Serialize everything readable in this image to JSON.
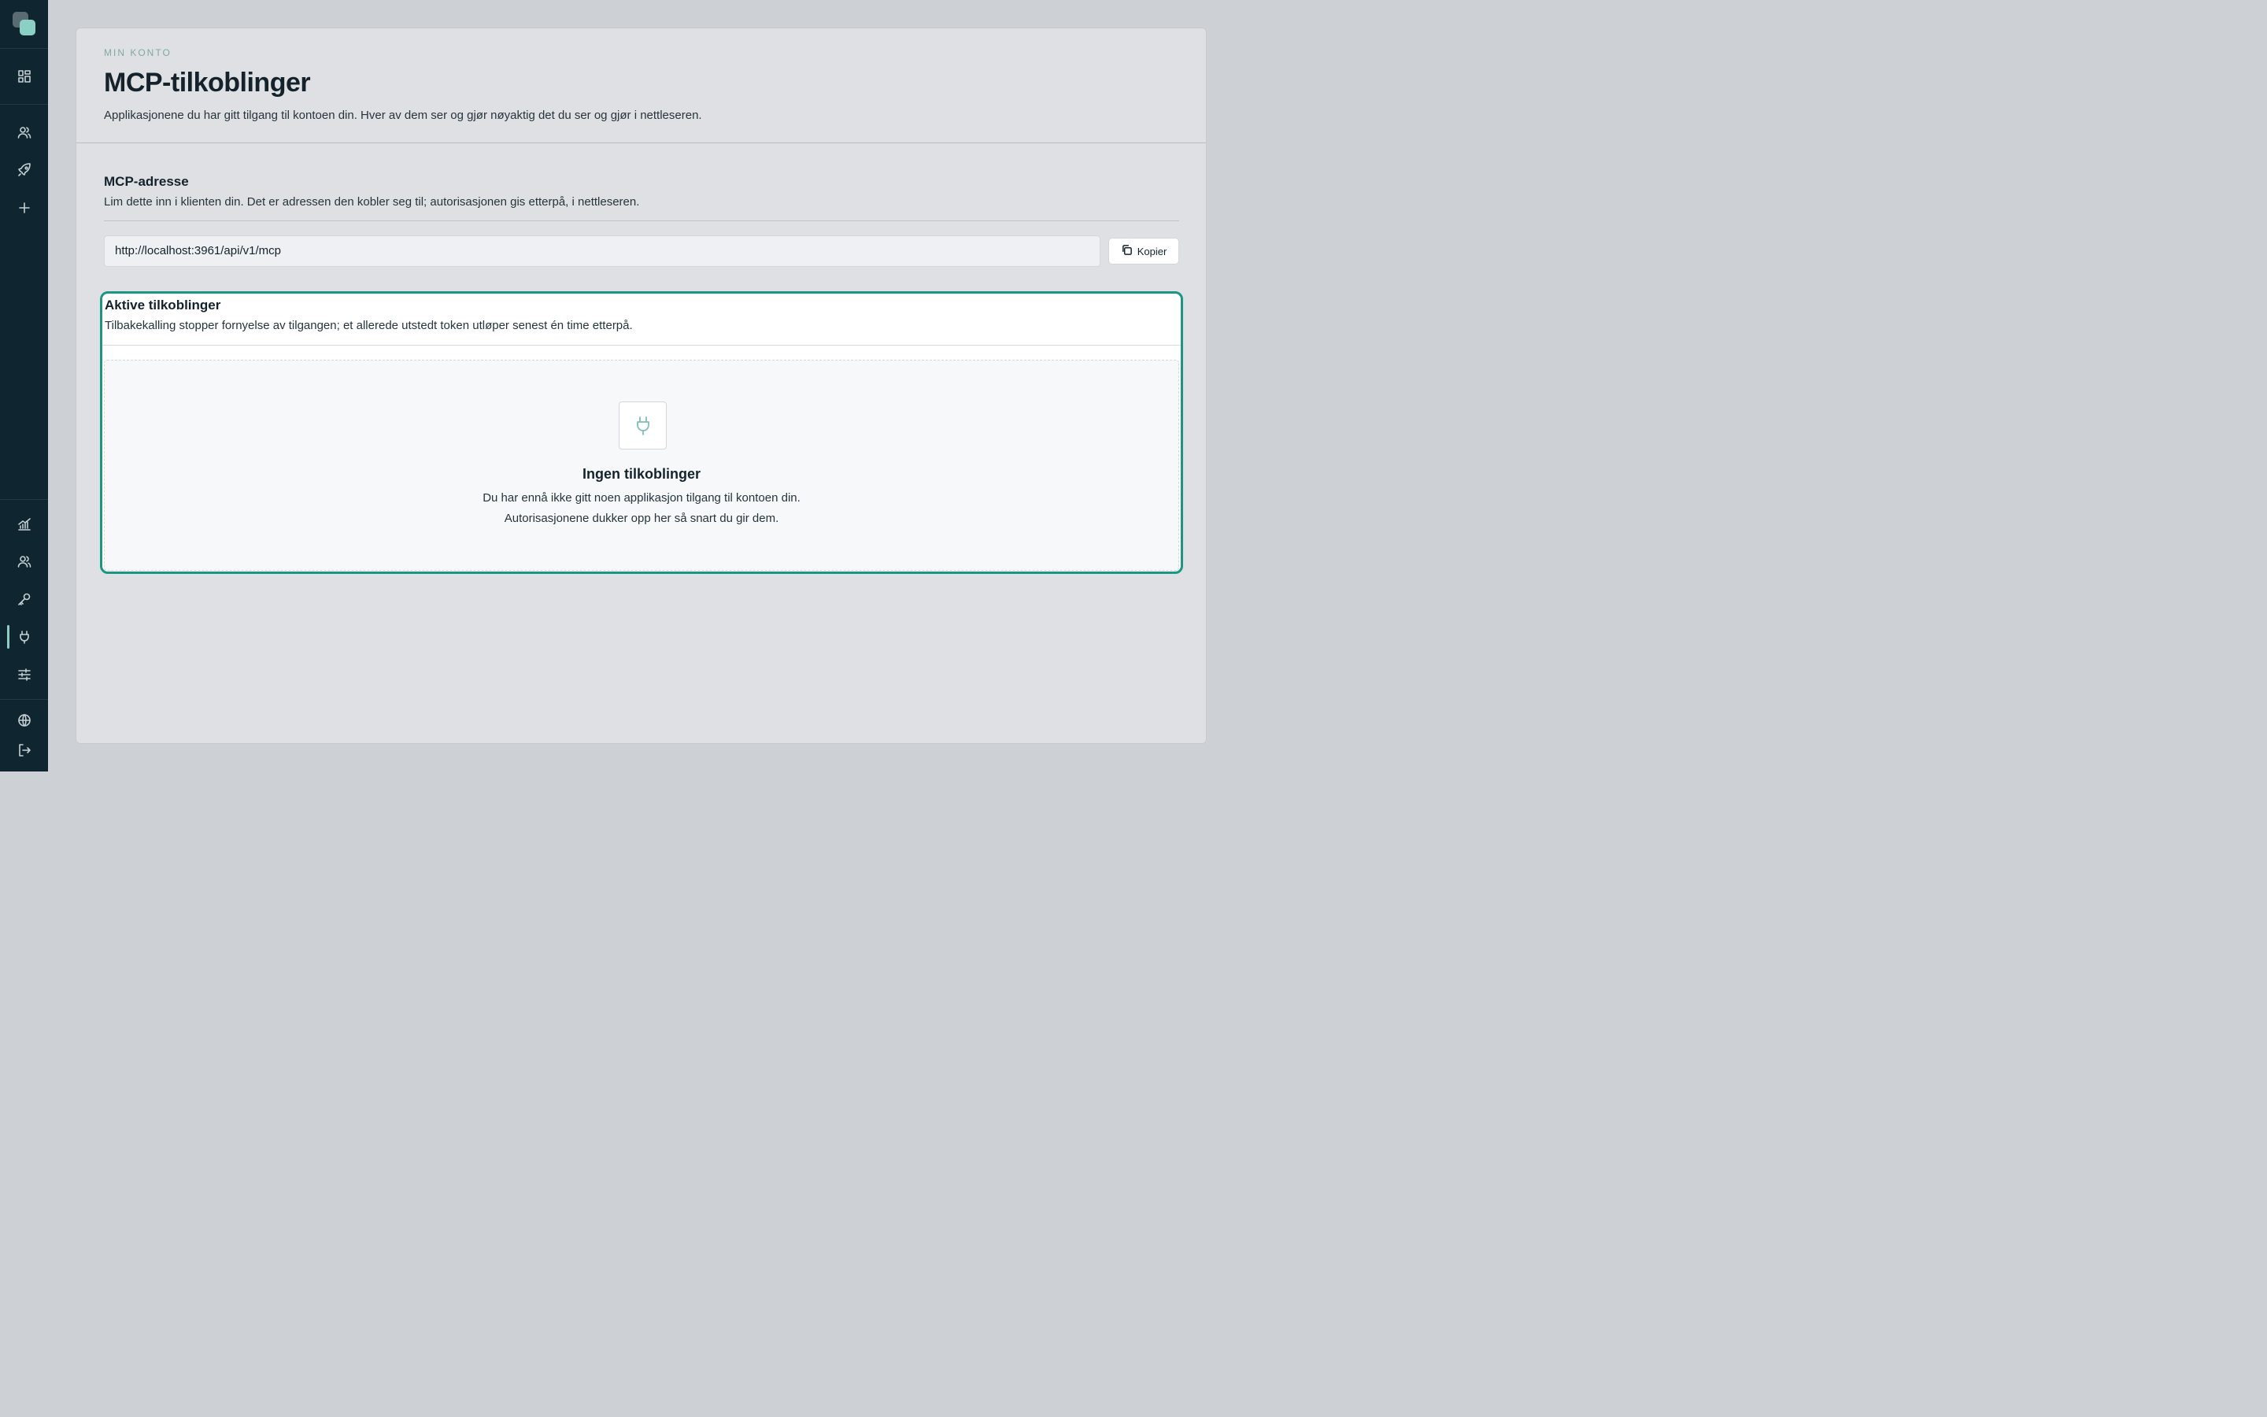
{
  "sidebar": {
    "logo": "app-logo",
    "top_items": [
      {
        "icon": "dashboard-icon"
      },
      {
        "icon": "users-icon"
      },
      {
        "icon": "rocket-icon"
      },
      {
        "icon": "plus-icon"
      }
    ],
    "bottom_items": [
      {
        "icon": "chart-icon"
      },
      {
        "icon": "users-icon"
      },
      {
        "icon": "key-icon"
      },
      {
        "icon": "plug-icon",
        "active": true
      },
      {
        "icon": "sliders-icon"
      }
    ],
    "footer_items": [
      {
        "icon": "globe-icon"
      },
      {
        "icon": "logout-icon"
      }
    ]
  },
  "header": {
    "eyebrow": "MIN KONTO",
    "title": "MCP-tilkoblinger",
    "subtitle": "Applikasjonene du har gitt tilgang til kontoen din. Hver av dem ser og gjør nøyaktig det du ser og gjør i nettleseren."
  },
  "mcp_address": {
    "title": "MCP-adresse",
    "subtitle": "Lim dette inn i klienten din. Det er adressen den kobler seg til; autorisasjonen gis etterpå, i nettleseren.",
    "url": "http://localhost:3961/api/v1/mcp",
    "copy_label": "Kopier"
  },
  "active_connections": {
    "title": "Aktive tilkoblinger",
    "subtitle": "Tilbakekalling stopper fornyelse av tilgangen; et allerede utstedt token utløper senest én time etterpå.",
    "empty": {
      "icon": "plug-icon",
      "title": "Ingen tilkoblinger",
      "line1": "Du har ennå ikke gitt noen applikasjon tilgang til kontoen din.",
      "line2": "Autorisasjonene dukker opp her så snart du gir dem."
    }
  },
  "colors": {
    "sidebar_bg": "#0f2530",
    "accent": "#1a9684",
    "accent_light": "#8ad0c4"
  }
}
